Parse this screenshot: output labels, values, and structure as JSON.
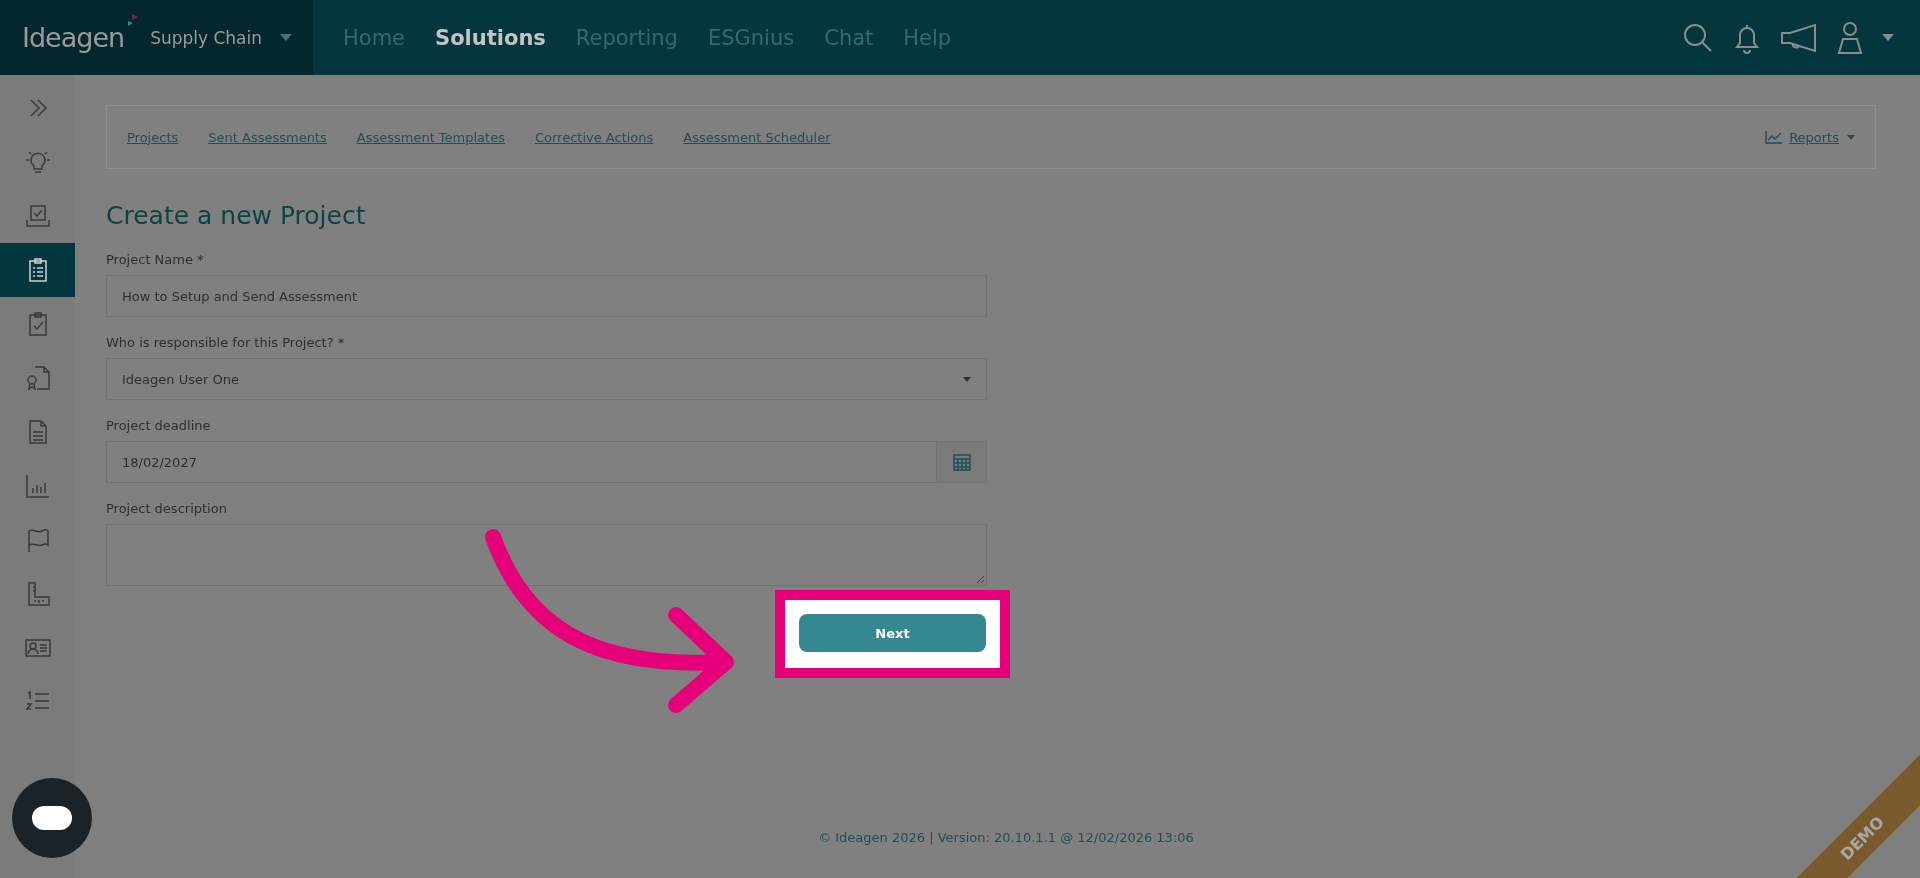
{
  "header": {
    "brand": "Ideagen",
    "product": "Supply Chain",
    "nav": [
      {
        "label": "Home",
        "selected": false
      },
      {
        "label": "Solutions",
        "selected": true
      },
      {
        "label": "Reporting",
        "selected": false
      },
      {
        "label": "ESGnius",
        "selected": false
      },
      {
        "label": "Chat",
        "selected": false
      },
      {
        "label": "Help",
        "selected": false
      }
    ]
  },
  "sidebar": {
    "items": [
      {
        "kind": "expand",
        "selected": false
      },
      {
        "kind": "lightbulb",
        "selected": false
      },
      {
        "kind": "tray",
        "selected": false
      },
      {
        "kind": "clipboard-list",
        "selected": true
      },
      {
        "kind": "clipboard-check",
        "selected": false
      },
      {
        "kind": "certificate",
        "selected": false
      },
      {
        "kind": "document",
        "selected": false
      },
      {
        "kind": "chart",
        "selected": false
      },
      {
        "kind": "flag",
        "selected": false
      },
      {
        "kind": "ruler",
        "selected": false
      },
      {
        "kind": "id-card",
        "selected": false
      },
      {
        "kind": "numbered-list",
        "selected": false
      }
    ]
  },
  "subnav": {
    "links": [
      "Projects",
      "Sent Assessments",
      "Assessment Templates",
      "Corrective Actions",
      "Assessment Scheduler"
    ],
    "reports": "Reports"
  },
  "form": {
    "title": "Create a new Project",
    "fields": [
      {
        "kind": "text",
        "label": "Project Name *",
        "value": "How to Setup and Send Assessment"
      },
      {
        "kind": "select",
        "label": "Who is responsible for this Project? *",
        "value": "Ideagen User One"
      },
      {
        "kind": "date",
        "label": "Project deadline",
        "value": "18/02/2027"
      },
      {
        "kind": "textarea",
        "label": "Project description"
      }
    ],
    "button": "Next"
  },
  "footer": "© Ideagen 2026 | Version: 20.10.1.1 @ 12/02/2026 13:06",
  "ribbon": "DEMO"
}
